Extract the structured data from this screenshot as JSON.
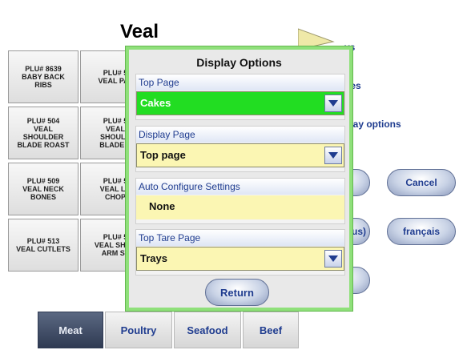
{
  "page": {
    "title": "Veal"
  },
  "plu_grid": [
    {
      "label": "PLU# 8639\nBABY BACK\nRIBS"
    },
    {
      "label": "PLU# 5\nVEAL PAT"
    },
    {
      "label": "PLU# 504\nVEAL\nSHOULDER\nBLADE ROAST"
    },
    {
      "label": "PLU# 5\nVEAL\nSHOULD\nBLADE S"
    },
    {
      "label": "PLU# 509\nVEAL NECK\nBONES"
    },
    {
      "label": "PLU# 5\nVEAL LO\nCHOP"
    },
    {
      "label": "PLU# 513\nVEAL CUTLETS"
    },
    {
      "label": "PLU# 5\nVEAL SHOU\nARM ST"
    }
  ],
  "right_links": [
    {
      "label": "ys"
    },
    {
      "label": "ges"
    },
    {
      "label": "play options"
    }
  ],
  "right_buttons": {
    "cancel": "Cancel",
    "francais": "français",
    "partial_us": "us)"
  },
  "tabs": [
    {
      "label": "Meat",
      "active": true
    },
    {
      "label": "Poultry",
      "active": false
    },
    {
      "label": "Seafood",
      "active": false
    },
    {
      "label": "Beef",
      "active": false
    }
  ],
  "dialog": {
    "title": "Display Options",
    "top_page": {
      "label": "Top Page",
      "value": "Cakes"
    },
    "display_page": {
      "label": "Display Page",
      "value": "Top page"
    },
    "auto_configure": {
      "label": "Auto Configure Settings",
      "value": "None"
    },
    "top_tare_page": {
      "label": "Top Tare Page",
      "value": "Trays"
    },
    "return_label": "Return"
  },
  "colors": {
    "accent_blue": "#1f3c8f",
    "dialog_border": "#8fe07a",
    "selected_green": "#22dd22",
    "field_yellow": "#fbf6b3",
    "active_tab": "#3b465e"
  }
}
